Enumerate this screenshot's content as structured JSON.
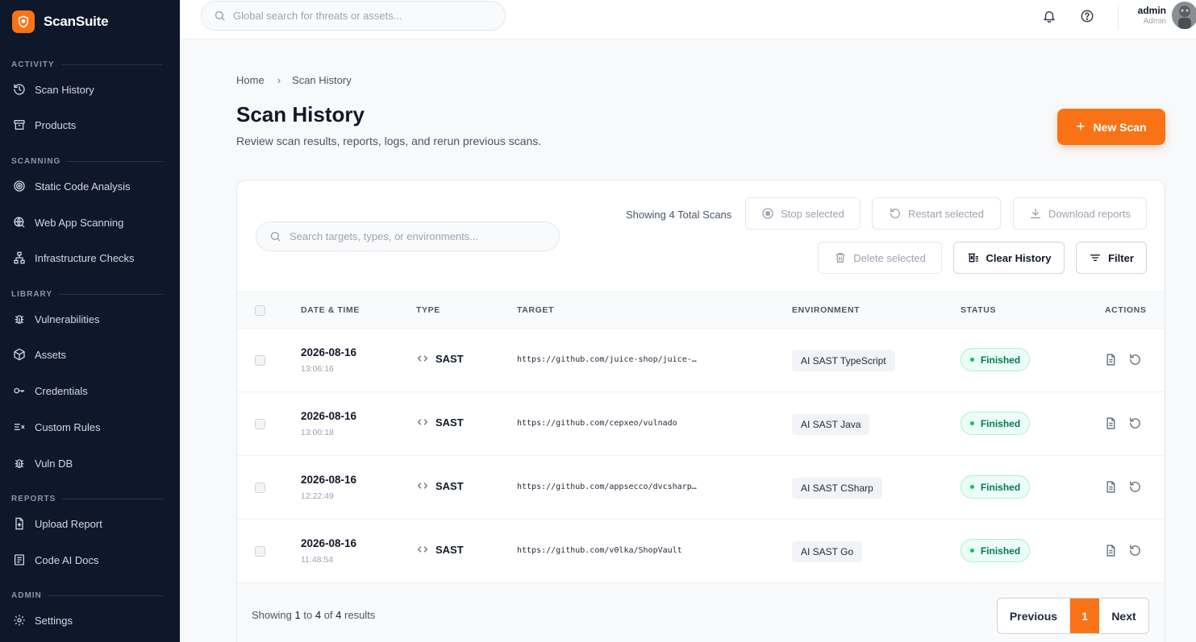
{
  "brand": {
    "name": "ScanSuite"
  },
  "sidebar": {
    "sections": [
      {
        "label": "ACTIVITY",
        "items": [
          {
            "label": "Scan History",
            "icon": "history-icon"
          },
          {
            "label": "Products",
            "icon": "archive-icon"
          }
        ]
      },
      {
        "label": "SCANNING",
        "items": [
          {
            "label": "Static Code Analysis",
            "icon": "target-icon"
          },
          {
            "label": "Web App Scanning",
            "icon": "globe-search-icon"
          },
          {
            "label": "Infrastructure Checks",
            "icon": "network-icon"
          }
        ]
      },
      {
        "label": "LIBRARY",
        "items": [
          {
            "label": "Vulnerabilities",
            "icon": "bug-icon"
          },
          {
            "label": "Assets",
            "icon": "cube-icon"
          },
          {
            "label": "Credentials",
            "icon": "key-icon"
          },
          {
            "label": "Custom Rules",
            "icon": "rules-icon"
          },
          {
            "label": "Vuln DB",
            "icon": "bug-icon"
          }
        ]
      },
      {
        "label": "REPORTS",
        "items": [
          {
            "label": "Upload Report",
            "icon": "file-upload-icon"
          },
          {
            "label": "Code AI Docs",
            "icon": "doc-icon"
          }
        ]
      },
      {
        "label": "ADMIN",
        "items": [
          {
            "label": "Settings",
            "icon": "gear-icon"
          }
        ]
      }
    ]
  },
  "topbar": {
    "search_placeholder": "Global search for threats or assets...",
    "user_name": "admin",
    "user_role": "Admin"
  },
  "breadcrumb": {
    "home": "Home",
    "current": "Scan History"
  },
  "page": {
    "title": "Scan History",
    "subtitle": "Review scan results, reports, logs, and rerun previous scans.",
    "new_scan_label": "New Scan"
  },
  "card": {
    "search_placeholder": "Search targets, types, or environments...",
    "showing_total": "Showing 4 Total Scans",
    "buttons": {
      "stop": "Stop selected",
      "restart": "Restart selected",
      "download": "Download reports",
      "delete": "Delete selected",
      "clear": "Clear History",
      "filter": "Filter"
    }
  },
  "table": {
    "columns": [
      "DATE & TIME",
      "TYPE",
      "TARGET",
      "ENVIRONMENT",
      "STATUS",
      "ACTIONS"
    ],
    "rows": [
      {
        "date": "2026-08-16",
        "time": "13:06:16",
        "type": "SAST",
        "target": "https://github.com/juice-shop/juice-…",
        "environment": "AI SAST TypeScript",
        "status": "Finished"
      },
      {
        "date": "2026-08-16",
        "time": "13:00:18",
        "type": "SAST",
        "target": "https://github.com/cepxeo/vulnado",
        "environment": "AI SAST Java",
        "status": "Finished"
      },
      {
        "date": "2026-08-16",
        "time": "12:22:49",
        "type": "SAST",
        "target": "https://github.com/appsecco/dvcsharp…",
        "environment": "AI SAST CSharp",
        "status": "Finished"
      },
      {
        "date": "2026-08-16",
        "time": "11:48:54",
        "type": "SAST",
        "target": "https://github.com/v0lka/ShopVault",
        "environment": "AI SAST Go",
        "status": "Finished"
      }
    ]
  },
  "footer": {
    "showing_prefix": "Showing",
    "from": "1",
    "to_word": "to",
    "to": "4",
    "of_word": "of",
    "total": "4",
    "suffix": "results",
    "prev_label": "Previous",
    "current_page": "1",
    "next_label": "Next"
  },
  "colors": {
    "accent": "#f97316",
    "sidebar_bg": "#0f172a",
    "success": "#10b981"
  }
}
